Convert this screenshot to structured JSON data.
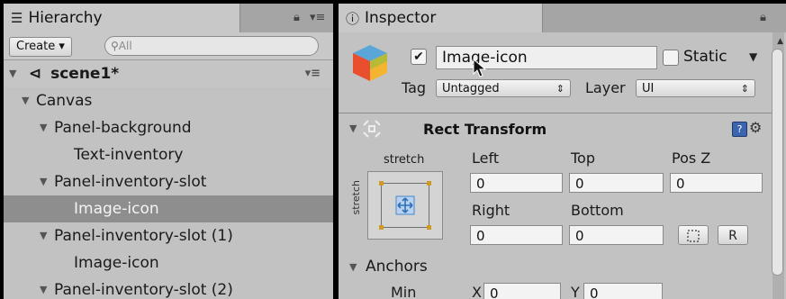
{
  "hierarchy": {
    "tab_label": "Hierarchy",
    "create_label": "Create ▾",
    "search_placeholder": "All",
    "scene_name": "scene1*",
    "rows": [
      {
        "label": "Canvas"
      },
      {
        "label": "Panel-background"
      },
      {
        "label": "Text-inventory"
      },
      {
        "label": "Panel-inventory-slot"
      },
      {
        "label": "Image-icon"
      },
      {
        "label": "Panel-inventory-slot (1)"
      },
      {
        "label": "Image-icon"
      },
      {
        "label": "Panel-inventory-slot (2)"
      }
    ],
    "selected_row": "Image-icon"
  },
  "inspector": {
    "tab_label": "Inspector",
    "object_name": "Image-icon",
    "active_checked": true,
    "static_label": "Static",
    "tag_label": "Tag",
    "tag_value": "Untagged",
    "layer_label": "Layer",
    "layer_value": "UI",
    "component": {
      "title": "Rect Transform",
      "stretch_h": "stretch",
      "stretch_v": "stretch",
      "labels": {
        "left": "Left",
        "top": "Top",
        "posz": "Pos Z",
        "right": "Right",
        "bottom": "Bottom"
      },
      "values": {
        "left": "0",
        "top": "0",
        "posz": "0",
        "right": "0",
        "bottom": "0"
      },
      "r_button": "R"
    },
    "anchors": {
      "label": "Anchors",
      "min_label": "Min",
      "x_label": "X",
      "x_value": "0",
      "y_label": "Y",
      "y_value": "0"
    }
  },
  "colors": {
    "panel_bg": "#c2c2c2",
    "selection": "#8e8e8e",
    "help_blue": "#3a66b0"
  }
}
